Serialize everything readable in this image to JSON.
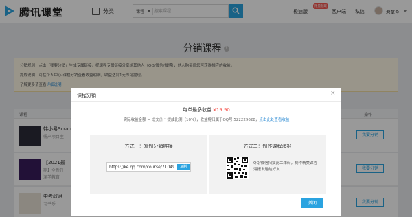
{
  "header": {
    "logo_text": "腾讯课堂",
    "category_label": "分类",
    "search": {
      "type_label": "课程",
      "placeholder": "搜索课程"
    },
    "nav": {
      "teach": "极速版",
      "teach_badge": "限量领取",
      "client": "客户端",
      "messages": "私信"
    },
    "user_name": "君莫今"
  },
  "page": {
    "title": "分销课程",
    "rules": {
      "line1": "分销规则：点击「我要分销」生成专属链接，把课程专属链接分享给其他人（QQ/微信/微博），他人购买后您可获得相应的收益。",
      "line2": "提成说明：可在个人中心-课程分销查看收益明细，收益达到1元即可提现。",
      "line3_text": "了解更多请查看",
      "line3_link": "详细说明"
    },
    "list_header": {
      "course": "课程",
      "action": "操作"
    },
    "courses": [
      {
        "name": "韩小易Scratch",
        "line2": "儒产项目主",
        "org": "",
        "button": "我要分销"
      },
      {
        "name": "【2021最",
        "line2": "期】全新升",
        "org": "深学教育",
        "button": "我要分销"
      },
      {
        "name": "中考政治",
        "line2": "",
        "org": "习书乐",
        "button": "我要分销"
      }
    ]
  },
  "modal": {
    "title": "课程分销",
    "close_icon": "×",
    "max_income_label": "每单最多收益",
    "max_income_value": "¥19.90",
    "calc_text": "实际收益金额 = 成交价 * 提成比例（10%），收益将归属于QQ号 522229628，",
    "calc_link": "点击此处查看收益",
    "method1": {
      "title": "方式一：复制分销链接",
      "link": "https://ke.qq.com/course/710496?s...",
      "copy_label": "复制"
    },
    "method2": {
      "title": "方式二：制作课程海报",
      "desc": "QQ/微信扫描此二维码，制作精美课程海报发送给好友"
    },
    "close_label": "关闭"
  },
  "colors": {
    "accent": "#2aa3e0",
    "price": "#f5564f",
    "overlay": "rgba(0,0,0,0.40)"
  }
}
